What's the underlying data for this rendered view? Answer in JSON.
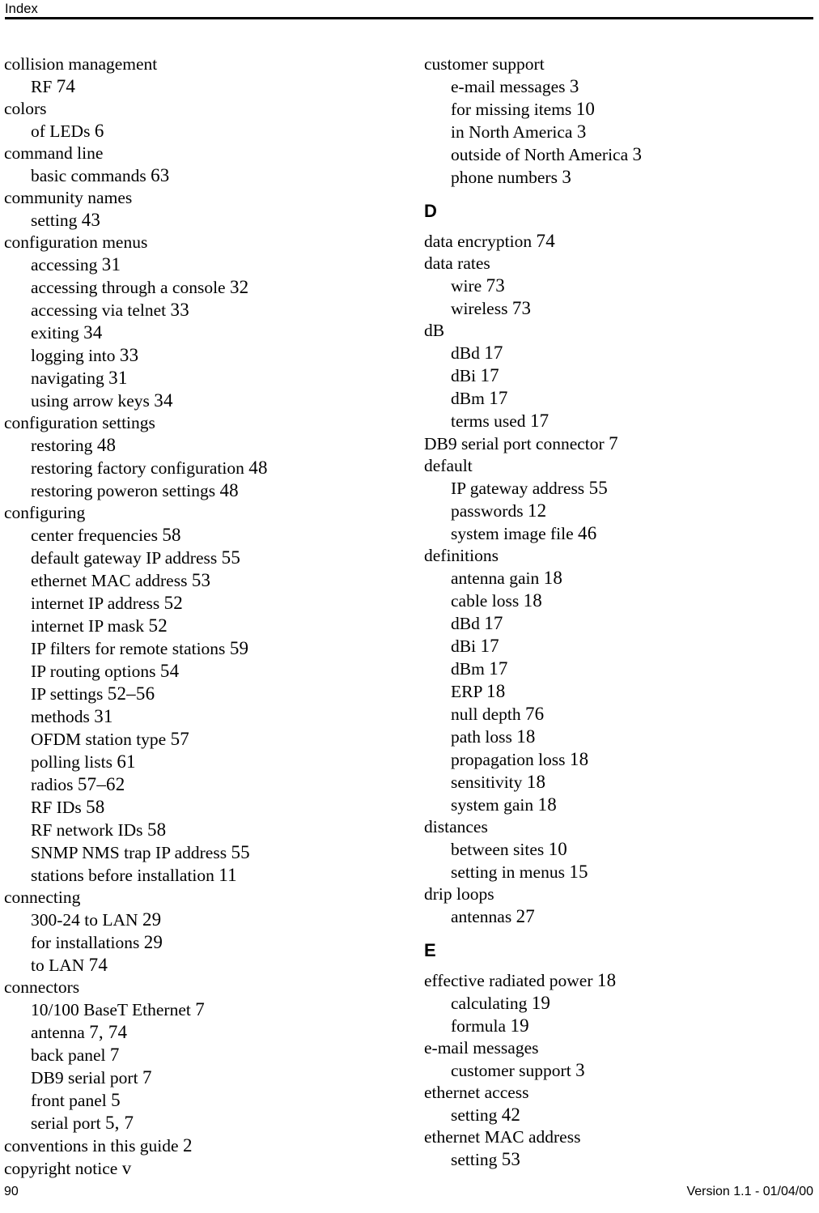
{
  "header": {
    "title": "Index"
  },
  "footer": {
    "page_number": "90",
    "version": "Version 1.1 - 01/04/00"
  },
  "columns": [
    {
      "name": "left-column",
      "blocks": [
        {
          "kind": "entry",
          "level": 1,
          "text": "collision management",
          "pages": ""
        },
        {
          "kind": "entry",
          "level": 2,
          "text": "RF",
          "pages": "74"
        },
        {
          "kind": "entry",
          "level": 1,
          "text": "colors",
          "pages": ""
        },
        {
          "kind": "entry",
          "level": 2,
          "text": "of LEDs",
          "pages": "6"
        },
        {
          "kind": "entry",
          "level": 1,
          "text": "command line",
          "pages": ""
        },
        {
          "kind": "entry",
          "level": 2,
          "text": "basic commands",
          "pages": "63"
        },
        {
          "kind": "entry",
          "level": 1,
          "text": "community names",
          "pages": ""
        },
        {
          "kind": "entry",
          "level": 2,
          "text": "setting",
          "pages": "43"
        },
        {
          "kind": "entry",
          "level": 1,
          "text": "configuration menus",
          "pages": ""
        },
        {
          "kind": "entry",
          "level": 2,
          "text": "accessing",
          "pages": "31"
        },
        {
          "kind": "entry",
          "level": 2,
          "text": "accessing through a console",
          "pages": "32"
        },
        {
          "kind": "entry",
          "level": 2,
          "text": "accessing via telnet",
          "pages": "33"
        },
        {
          "kind": "entry",
          "level": 2,
          "text": "exiting",
          "pages": "34"
        },
        {
          "kind": "entry",
          "level": 2,
          "text": "logging into",
          "pages": "33"
        },
        {
          "kind": "entry",
          "level": 2,
          "text": "navigating",
          "pages": "31"
        },
        {
          "kind": "entry",
          "level": 2,
          "text": "using arrow keys",
          "pages": "34"
        },
        {
          "kind": "entry",
          "level": 1,
          "text": "configuration settings",
          "pages": ""
        },
        {
          "kind": "entry",
          "level": 2,
          "text": "restoring",
          "pages": "48"
        },
        {
          "kind": "entry",
          "level": 2,
          "text": "restoring factory configuration",
          "pages": "48"
        },
        {
          "kind": "entry",
          "level": 2,
          "text": "restoring poweron settings",
          "pages": "48"
        },
        {
          "kind": "entry",
          "level": 1,
          "text": "configuring",
          "pages": ""
        },
        {
          "kind": "entry",
          "level": 2,
          "text": "center frequencies",
          "pages": "58"
        },
        {
          "kind": "entry",
          "level": 2,
          "text": "default gateway IP address",
          "pages": "55"
        },
        {
          "kind": "entry",
          "level": 2,
          "text": "ethernet MAC address",
          "pages": "53"
        },
        {
          "kind": "entry",
          "level": 2,
          "text": "internet IP address",
          "pages": "52"
        },
        {
          "kind": "entry",
          "level": 2,
          "text": "internet IP mask",
          "pages": "52"
        },
        {
          "kind": "entry",
          "level": 2,
          "text": "IP filters for remote stations",
          "pages": "59"
        },
        {
          "kind": "entry",
          "level": 2,
          "text": "IP routing options",
          "pages": "54"
        },
        {
          "kind": "entry",
          "level": 2,
          "text": "IP settings",
          "pages": "52–56"
        },
        {
          "kind": "entry",
          "level": 2,
          "text": "methods",
          "pages": "31"
        },
        {
          "kind": "entry",
          "level": 2,
          "text": "OFDM station type",
          "pages": "57"
        },
        {
          "kind": "entry",
          "level": 2,
          "text": "polling lists",
          "pages": "61"
        },
        {
          "kind": "entry",
          "level": 2,
          "text": "radios",
          "pages": "57–62"
        },
        {
          "kind": "entry",
          "level": 2,
          "text": "RF IDs",
          "pages": "58"
        },
        {
          "kind": "entry",
          "level": 2,
          "text": "RF network IDs",
          "pages": "58"
        },
        {
          "kind": "entry",
          "level": 2,
          "text": "SNMP NMS trap IP address",
          "pages": "55"
        },
        {
          "kind": "entry",
          "level": 2,
          "text": "stations before installation",
          "pages": "11"
        },
        {
          "kind": "entry",
          "level": 1,
          "text": "connecting",
          "pages": ""
        },
        {
          "kind": "entry",
          "level": 2,
          "text": "300-24 to LAN",
          "pages": "29"
        },
        {
          "kind": "entry",
          "level": 2,
          "text": "for installations",
          "pages": "29"
        },
        {
          "kind": "entry",
          "level": 2,
          "text": "to LAN",
          "pages": "74"
        },
        {
          "kind": "entry",
          "level": 1,
          "text": "connectors",
          "pages": ""
        },
        {
          "kind": "entry",
          "level": 2,
          "text": "10/100 BaseT Ethernet",
          "pages": "7"
        },
        {
          "kind": "entry",
          "level": 2,
          "text": "antenna",
          "pages": "7, 74"
        },
        {
          "kind": "entry",
          "level": 2,
          "text": "back panel",
          "pages": "7"
        },
        {
          "kind": "entry",
          "level": 2,
          "text": "DB9 serial port",
          "pages": "7"
        },
        {
          "kind": "entry",
          "level": 2,
          "text": "front panel",
          "pages": "5"
        },
        {
          "kind": "entry",
          "level": 2,
          "text": "serial port",
          "pages": "5, 7"
        },
        {
          "kind": "entry",
          "level": 1,
          "text": "conventions in this guide",
          "pages": "2"
        },
        {
          "kind": "entry",
          "level": 1,
          "text": "copyright notice",
          "pages": "v"
        }
      ]
    },
    {
      "name": "right-column",
      "blocks": [
        {
          "kind": "entry",
          "level": 1,
          "text": "customer support",
          "pages": ""
        },
        {
          "kind": "entry",
          "level": 2,
          "text": "e-mail messages",
          "pages": "3"
        },
        {
          "kind": "entry",
          "level": 2,
          "text": "for missing items",
          "pages": "10"
        },
        {
          "kind": "entry",
          "level": 2,
          "text": "in North America",
          "pages": "3"
        },
        {
          "kind": "entry",
          "level": 2,
          "text": "outside of North America",
          "pages": "3"
        },
        {
          "kind": "entry",
          "level": 2,
          "text": "phone numbers",
          "pages": "3"
        },
        {
          "kind": "letter",
          "letter": "D"
        },
        {
          "kind": "entry",
          "level": 1,
          "text": "data encryption",
          "pages": "74"
        },
        {
          "kind": "entry",
          "level": 1,
          "text": "data rates",
          "pages": ""
        },
        {
          "kind": "entry",
          "level": 2,
          "text": "wire",
          "pages": "73"
        },
        {
          "kind": "entry",
          "level": 2,
          "text": "wireless",
          "pages": "73"
        },
        {
          "kind": "entry",
          "level": 1,
          "text": "dB",
          "pages": ""
        },
        {
          "kind": "entry",
          "level": 2,
          "text": "dBd",
          "pages": "17"
        },
        {
          "kind": "entry",
          "level": 2,
          "text": "dBi",
          "pages": "17"
        },
        {
          "kind": "entry",
          "level": 2,
          "text": "dBm",
          "pages": "17"
        },
        {
          "kind": "entry",
          "level": 2,
          "text": "terms used",
          "pages": "17"
        },
        {
          "kind": "entry",
          "level": 1,
          "text": "DB9 serial port connector",
          "pages": "7"
        },
        {
          "kind": "entry",
          "level": 1,
          "text": "default",
          "pages": ""
        },
        {
          "kind": "entry",
          "level": 2,
          "text": "IP gateway address",
          "pages": "55"
        },
        {
          "kind": "entry",
          "level": 2,
          "text": "passwords",
          "pages": "12"
        },
        {
          "kind": "entry",
          "level": 2,
          "text": "system image file",
          "pages": "46"
        },
        {
          "kind": "entry",
          "level": 1,
          "text": "definitions",
          "pages": ""
        },
        {
          "kind": "entry",
          "level": 2,
          "text": "antenna gain",
          "pages": "18"
        },
        {
          "kind": "entry",
          "level": 2,
          "text": "cable loss",
          "pages": "18"
        },
        {
          "kind": "entry",
          "level": 2,
          "text": "dBd",
          "pages": "17"
        },
        {
          "kind": "entry",
          "level": 2,
          "text": "dBi",
          "pages": "17"
        },
        {
          "kind": "entry",
          "level": 2,
          "text": "dBm",
          "pages": "17"
        },
        {
          "kind": "entry",
          "level": 2,
          "text": "ERP",
          "pages": "18"
        },
        {
          "kind": "entry",
          "level": 2,
          "text": "null depth",
          "pages": "76"
        },
        {
          "kind": "entry",
          "level": 2,
          "text": "path loss",
          "pages": "18"
        },
        {
          "kind": "entry",
          "level": 2,
          "text": "propagation loss",
          "pages": "18"
        },
        {
          "kind": "entry",
          "level": 2,
          "text": "sensitivity",
          "pages": "18"
        },
        {
          "kind": "entry",
          "level": 2,
          "text": "system gain",
          "pages": "18"
        },
        {
          "kind": "entry",
          "level": 1,
          "text": "distances",
          "pages": ""
        },
        {
          "kind": "entry",
          "level": 2,
          "text": "between sites",
          "pages": "10"
        },
        {
          "kind": "entry",
          "level": 2,
          "text": "setting in menus",
          "pages": "15"
        },
        {
          "kind": "entry",
          "level": 1,
          "text": "drip loops",
          "pages": ""
        },
        {
          "kind": "entry",
          "level": 2,
          "text": "antennas",
          "pages": "27"
        },
        {
          "kind": "letter",
          "letter": "E"
        },
        {
          "kind": "entry",
          "level": 1,
          "text": "effective radiated power",
          "pages": "18"
        },
        {
          "kind": "entry",
          "level": 2,
          "text": "calculating",
          "pages": "19"
        },
        {
          "kind": "entry",
          "level": 2,
          "text": "formula",
          "pages": "19"
        },
        {
          "kind": "entry",
          "level": 1,
          "text": "e-mail messages",
          "pages": ""
        },
        {
          "kind": "entry",
          "level": 2,
          "text": "customer support",
          "pages": "3"
        },
        {
          "kind": "entry",
          "level": 1,
          "text": "ethernet access",
          "pages": ""
        },
        {
          "kind": "entry",
          "level": 2,
          "text": "setting",
          "pages": "42"
        },
        {
          "kind": "entry",
          "level": 1,
          "text": "ethernet MAC address",
          "pages": ""
        },
        {
          "kind": "entry",
          "level": 2,
          "text": "setting",
          "pages": "53"
        }
      ]
    }
  ]
}
